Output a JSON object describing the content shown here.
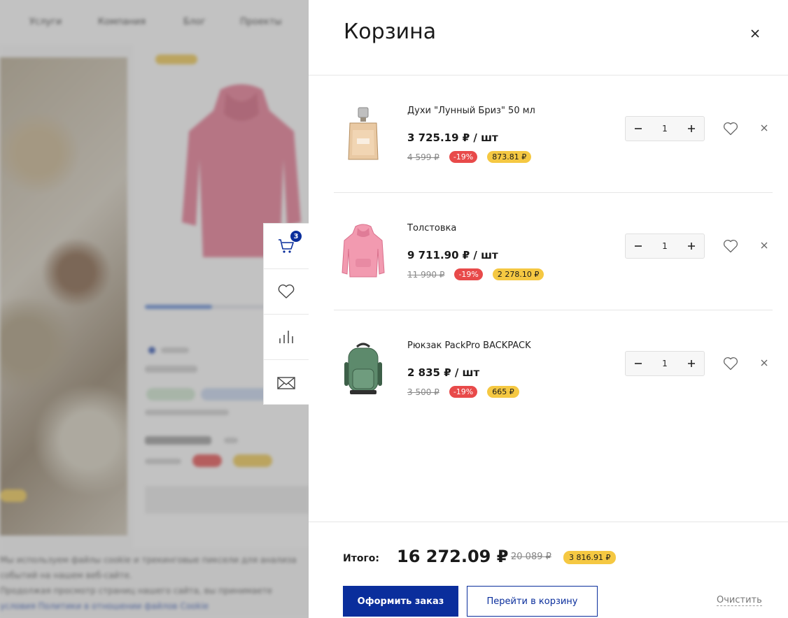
{
  "colors": {
    "accent": "#0a2e9c",
    "discount": "#e84a4a",
    "bonus": "#f5c842"
  },
  "background_page": {
    "nav": [
      "Услуги",
      "Компания",
      "Блог",
      "Проекты"
    ],
    "bottom_text": [
      "Мы используем файлы cookie и трекинговые пиксели для анализа событий на нашем веб-сайте.",
      "Продолжая просмотр страниц нашего сайта, вы принимаете",
      "условия Политики в отношении файлов Cookie"
    ]
  },
  "side_toolbar": {
    "cart_count": "3",
    "icons": [
      "cart-icon",
      "heart-icon",
      "compare-icon",
      "mail-icon"
    ]
  },
  "cart": {
    "title": "Корзина",
    "items": [
      {
        "name": "Духи \"Лунный Бриз\" 50 мл",
        "price": "3 725.19 ₽ / шт",
        "old_price": "4 599 ₽",
        "discount": "-19%",
        "bonus": "873.81 ₽",
        "qty": "1",
        "image": "perfume-bottle"
      },
      {
        "name": "Толстовка",
        "price": "9 711.90 ₽ / шт",
        "old_price": "11 990 ₽",
        "discount": "-19%",
        "bonus": "2 278.10 ₽",
        "qty": "1",
        "image": "pink-hoodie"
      },
      {
        "name": "Рюкзак PackPro BACKPACK",
        "price": "2 835 ₽ / шт",
        "old_price": "3 500 ₽",
        "discount": "-19%",
        "bonus": "665 ₽",
        "qty": "1",
        "image": "green-backpack"
      }
    ],
    "total_label": "Итого:",
    "total": "16 272.09 ₽",
    "total_old": "20 089 ₽",
    "total_bonus": "3 816.91 ₽",
    "checkout_label": "Оформить заказ",
    "go_to_cart_label": "Перейти в корзину",
    "clear_label": "Очистить"
  }
}
